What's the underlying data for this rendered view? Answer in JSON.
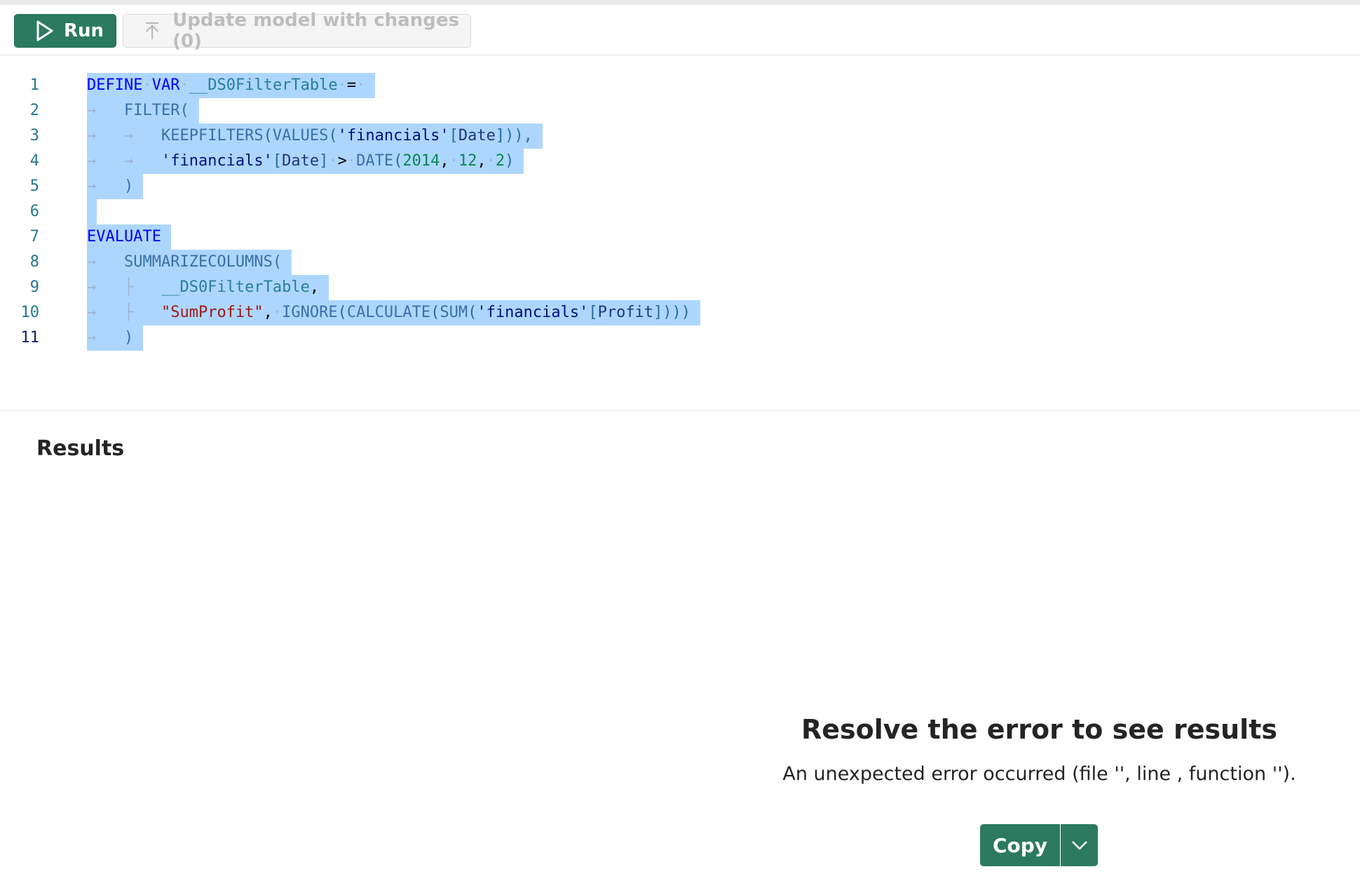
{
  "toolbar": {
    "run_label": "Run",
    "update_label": "Update model with changes (0)"
  },
  "editor": {
    "line_numbers": [
      "1",
      "2",
      "3",
      "4",
      "5",
      "6",
      "7",
      "8",
      "9",
      "10",
      "11"
    ],
    "lines": [
      "DEFINE VAR __DS0FilterTable =",
      "FILTER(",
      "KEEPFILTERS(VALUES('financials'[Date])),",
      "'financials'[Date] > DATE(2014, 12, 2)",
      ")",
      "",
      "EVALUATE",
      "SUMMARIZECOLUMNS(",
      "__DS0FilterTable,",
      "\"SumProfit\", IGNORE(CALCULATE(SUM('financials'[Profit])))",
      ")"
    ]
  },
  "results": {
    "title": "Results",
    "error_title": "Resolve the error to see results",
    "error_message": "An unexpected error occurred (file '', line , function '').",
    "copy_label": "Copy"
  },
  "colors": {
    "accent": "#2b7a60",
    "selection": "#add6ff"
  }
}
